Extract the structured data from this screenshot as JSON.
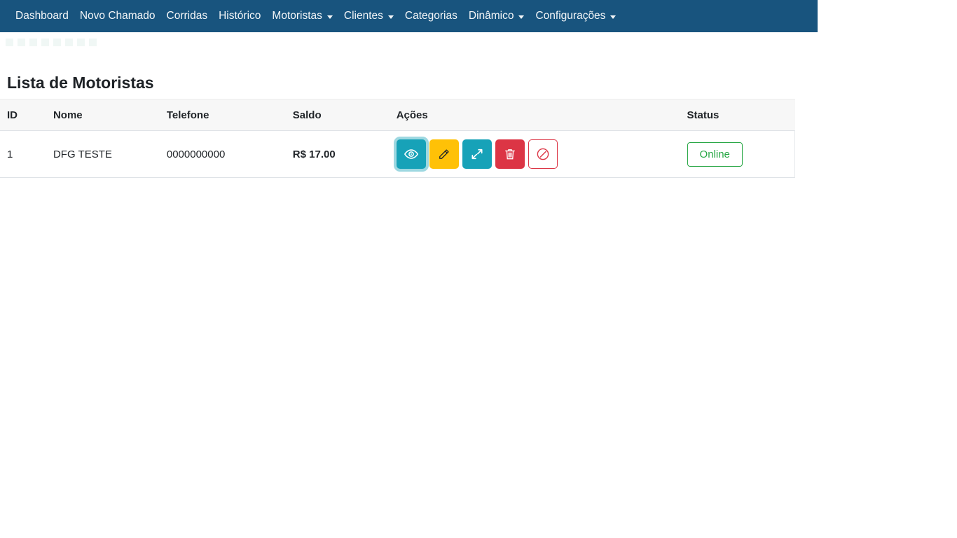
{
  "navbar": {
    "background": "#18547e",
    "items": [
      {
        "label": "Dashboard",
        "has_dropdown": false
      },
      {
        "label": "Novo Chamado",
        "has_dropdown": false
      },
      {
        "label": "Corridas",
        "has_dropdown": false
      },
      {
        "label": "Histórico",
        "has_dropdown": false
      },
      {
        "label": "Motoristas",
        "has_dropdown": true
      },
      {
        "label": "Clientes",
        "has_dropdown": true
      },
      {
        "label": "Categorias",
        "has_dropdown": false
      },
      {
        "label": "Dinâmico",
        "has_dropdown": true
      },
      {
        "label": "Configurações",
        "has_dropdown": true
      }
    ]
  },
  "page": {
    "title": "Lista de Motoristas"
  },
  "table": {
    "columns": [
      "ID",
      "Nome",
      "Telefone",
      "Saldo",
      "Ações",
      "Status"
    ],
    "rows": [
      {
        "id": "1",
        "nome": "DFG TESTE",
        "telefone": "0000000000",
        "saldo": "R$ 17.00",
        "status": "Online"
      }
    ]
  },
  "actions": {
    "view": {
      "icon": "eye-icon",
      "color": "#17a2b8"
    },
    "edit": {
      "icon": "pencil-icon",
      "color": "#ffc107"
    },
    "expand": {
      "icon": "arrows-expand-icon",
      "color": "#17a2b8"
    },
    "delete": {
      "icon": "trash-icon",
      "color": "#dc3545"
    },
    "block": {
      "icon": "slash-circle-icon",
      "color": "#dc3545"
    }
  },
  "colors": {
    "navbar": "#18547e",
    "teal": "#17a2b8",
    "yellow": "#ffc107",
    "red": "#dc3545",
    "green": "#28a745",
    "header_bg": "#f7f7f7",
    "border": "#dee2e6"
  }
}
